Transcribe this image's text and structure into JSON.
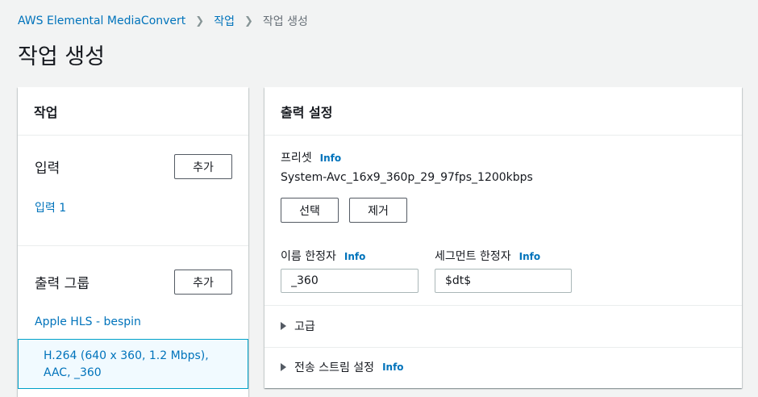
{
  "breadcrumb": {
    "items": [
      {
        "label": "AWS Elemental MediaConvert"
      },
      {
        "label": "작업"
      },
      {
        "label": "작업 생성"
      }
    ]
  },
  "page_title": "작업 생성",
  "left_panel": {
    "title": "작업",
    "inputs": {
      "label": "입력",
      "add_button": "추가",
      "items": [
        "입력 1"
      ]
    },
    "output_groups": {
      "label": "출력 그룹",
      "add_button": "추가",
      "group_name": "Apple HLS - bespin",
      "selected_output": "H.264 (640 x 360, 1.2 Mbps), AAC, _360"
    }
  },
  "right_panel": {
    "title": "출력 설정",
    "preset": {
      "label": "프리셋",
      "info": "Info",
      "value": "System-Avc_16x9_360p_29_97fps_1200kbps",
      "select_button": "선택",
      "remove_button": "제거"
    },
    "name_modifier": {
      "label": "이름 한정자",
      "info": "Info",
      "value": "_360"
    },
    "segment_modifier": {
      "label": "세그먼트 한정자",
      "info": "Info",
      "value": "$dt$"
    },
    "advanced": {
      "label": "고급"
    },
    "transport_stream": {
      "label": "전송 스트림 설정",
      "info": "Info"
    }
  },
  "colors": {
    "link": "#0073bb",
    "background": "#f2f3f3",
    "selected_bg": "#f1faff",
    "selected_border": "#00a1c9"
  }
}
